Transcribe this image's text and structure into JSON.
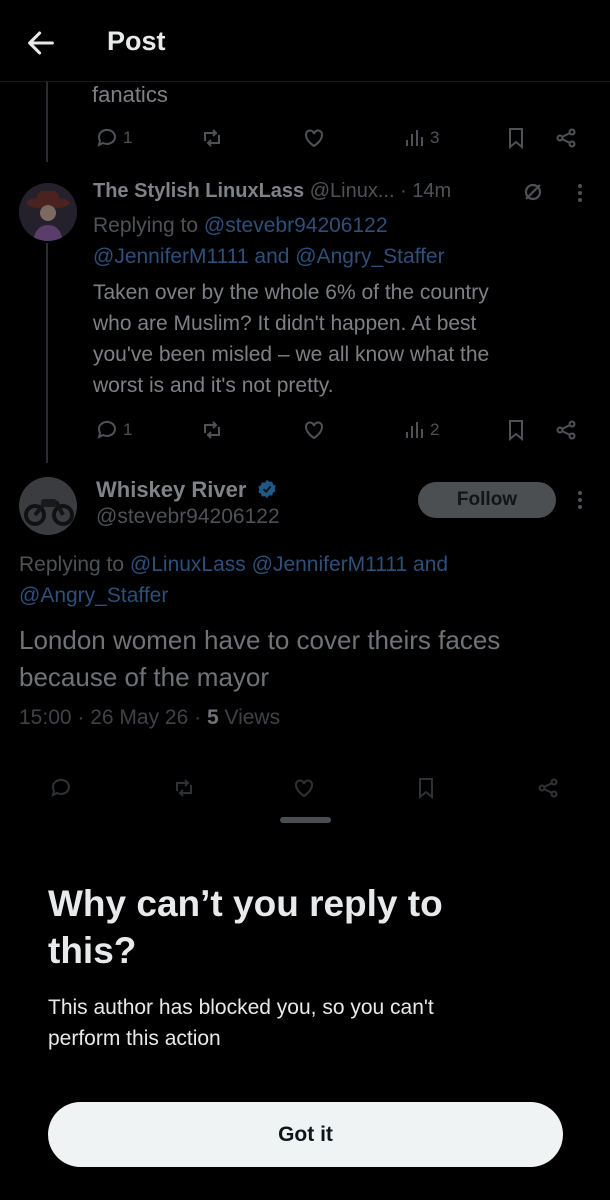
{
  "header": {
    "title": "Post"
  },
  "prev_post": {
    "text_fragment": "fanatics",
    "replies": "1",
    "views": "3"
  },
  "reply_post": {
    "name": "The Stylish LinuxLass",
    "handle": "@Linux...",
    "time": "· 14m",
    "replying_label": "Replying to",
    "replying_line1": "@stevebr94206122",
    "replying_line2": "@JenniferM1111 and @Angry_Staffer",
    "body_lines": [
      "Taken over by the whole 6% of the country",
      "who are Muslim? It didn't happen. At best",
      "you've been misled – we all know what the",
      "worst is and it's not pretty."
    ],
    "replies": "1",
    "views": "2"
  },
  "main_post": {
    "name": "Whiskey River",
    "handle": "@stevebr94206122",
    "follow_label": "Follow",
    "replying_label": "Replying to",
    "replying_line1": "@LinuxLass @JenniferM1111 and",
    "replying_line2": "@Angry_Staffer",
    "text_line1": "London women have to cover theirs faces",
    "text_line2": "because of the mayor",
    "timestamp": "15:00 · 26 May 26 · ",
    "views_count": "5",
    "views_label": " Views"
  },
  "sheet": {
    "title_line1": "Why can’t you reply to",
    "title_line2": "this?",
    "body_line1": "This author has blocked you, so you can't",
    "body_line2": "perform this action",
    "button": "Got it"
  },
  "colors": {
    "background": "#000000",
    "link": "#1d9bf0",
    "button_bg": "#eff3f4"
  }
}
